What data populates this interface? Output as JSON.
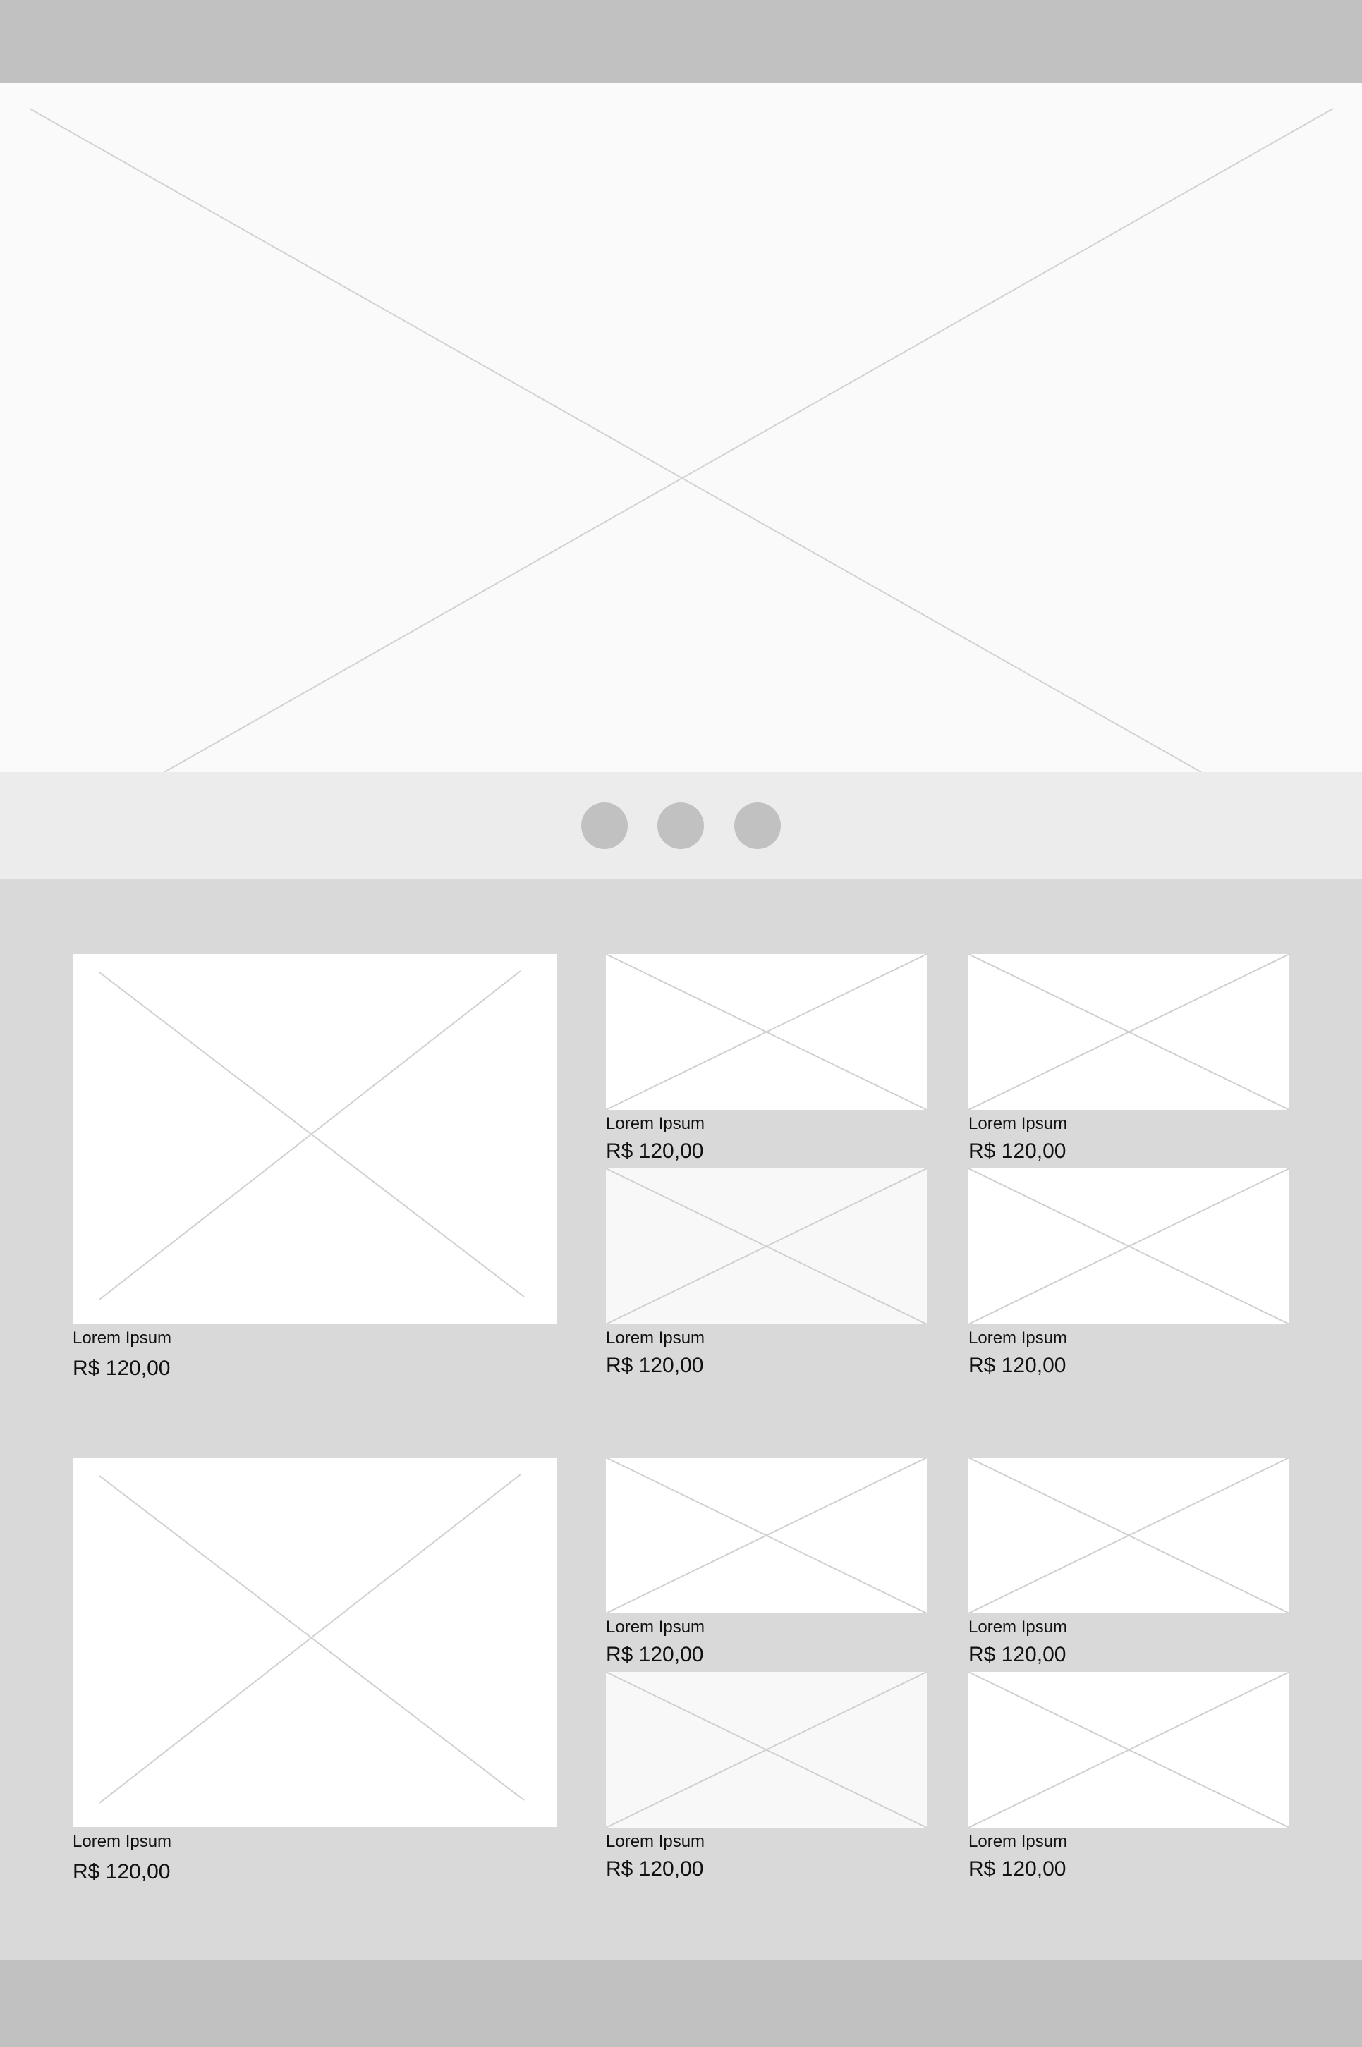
{
  "header": {},
  "carousel": {
    "dot_count": 3,
    "active_index": null
  },
  "colors": {
    "header_bg": "#c1c1c1",
    "hero_bg": "#fafafa",
    "dots_bar_bg": "#ececec",
    "main_bg": "#d9d9d9",
    "dot": "#c1c1c1",
    "placeholder_line": "#d0d0d0"
  },
  "products": {
    "group1": {
      "large": {
        "name": "Lorem Ipsum",
        "price": "R$ 120,00"
      },
      "items": [
        {
          "name": "Lorem Ipsum",
          "price": "R$ 120,00"
        },
        {
          "name": "Lorem Ipsum",
          "price": "R$ 120,00"
        },
        {
          "name": "Lorem Ipsum",
          "price": "R$ 120,00"
        },
        {
          "name": "Lorem Ipsum",
          "price": "R$ 120,00"
        }
      ]
    },
    "group2": {
      "large": {
        "name": "Lorem Ipsum",
        "price": "R$ 120,00"
      },
      "items": [
        {
          "name": "Lorem Ipsum",
          "price": "R$ 120,00"
        },
        {
          "name": "Lorem Ipsum",
          "price": "R$ 120,00"
        },
        {
          "name": "Lorem Ipsum",
          "price": "R$ 120,00"
        },
        {
          "name": "Lorem Ipsum",
          "price": "R$ 120,00"
        }
      ]
    }
  },
  "footer": {}
}
